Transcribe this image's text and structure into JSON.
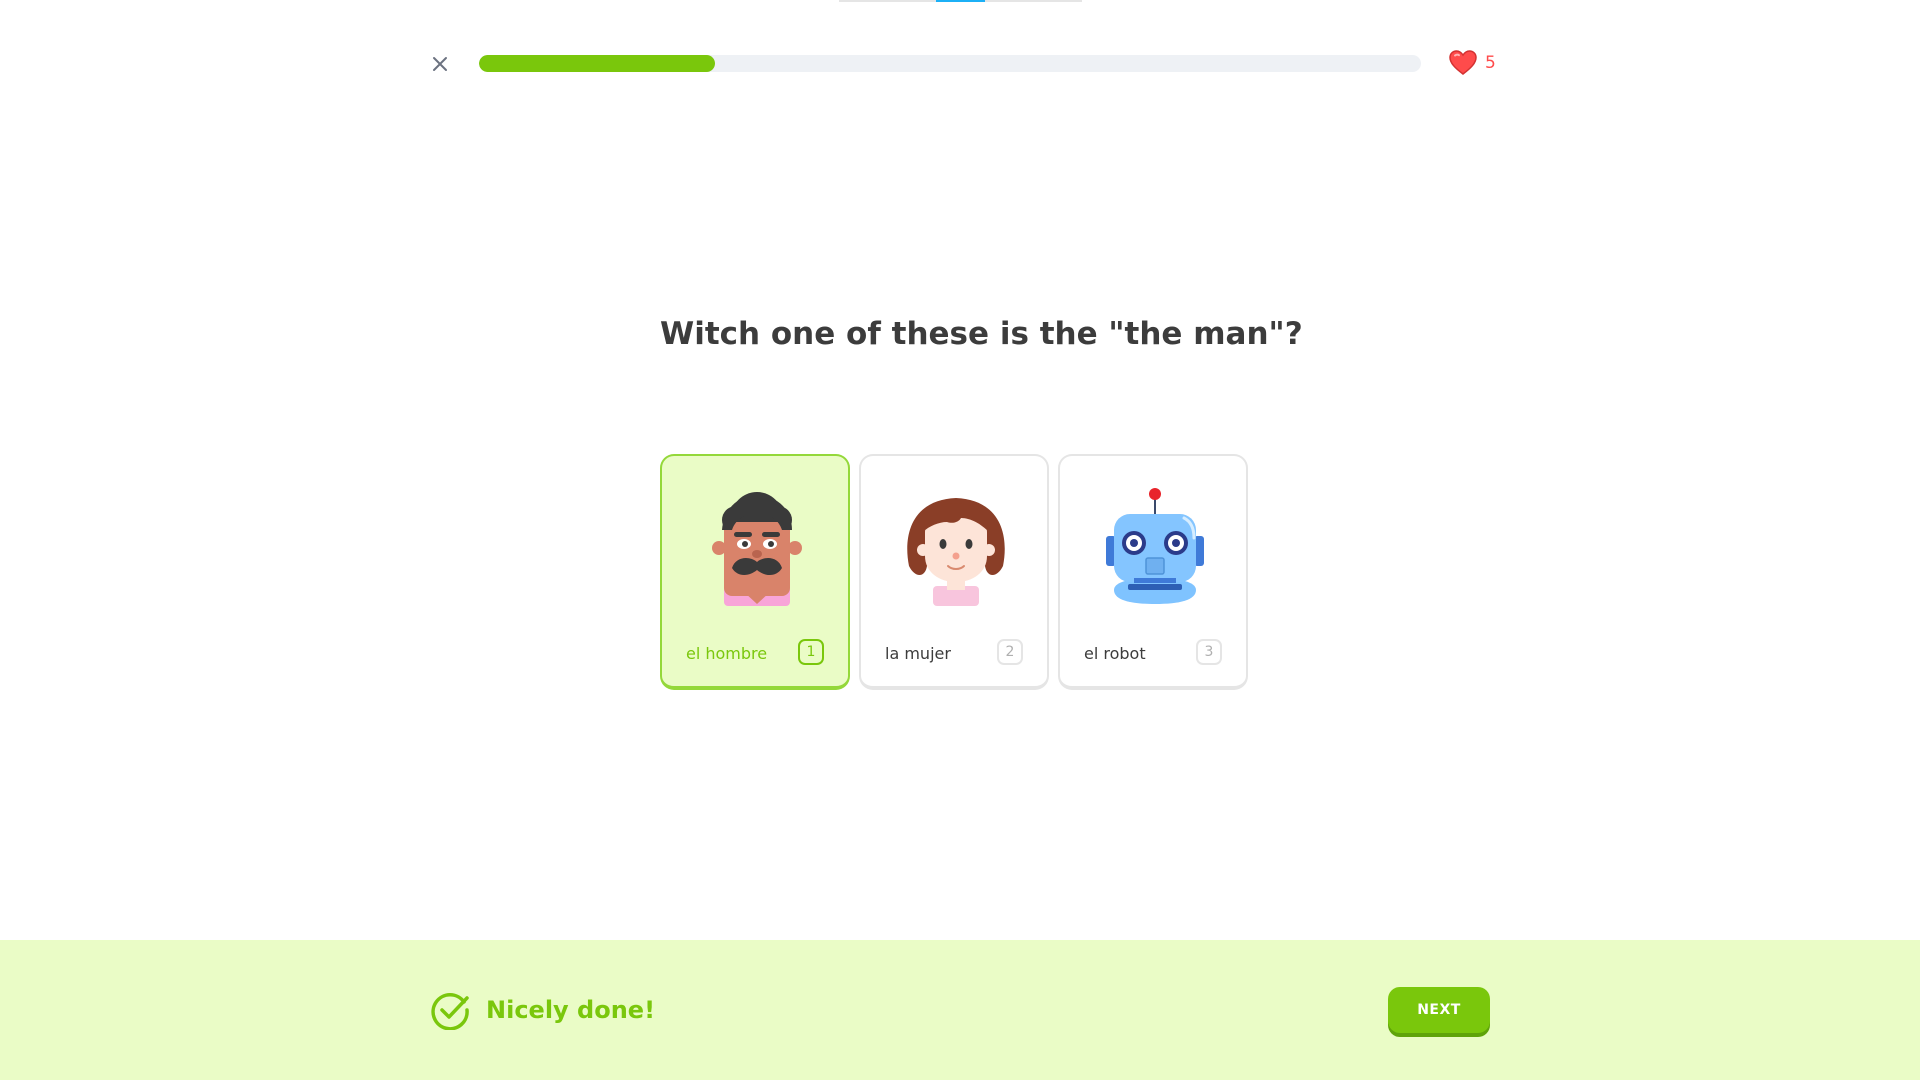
{
  "header": {
    "progress_fraction": 0.25,
    "hearts_count": "5",
    "close_icon": "close-icon",
    "heart_icon": "heart-icon"
  },
  "question": {
    "text": "Witch one of these is the \"the man\"?"
  },
  "choices": [
    {
      "label": "el hombre",
      "key": "1",
      "icon": "man-illustration",
      "selected": true
    },
    {
      "label": "la mujer",
      "key": "2",
      "icon": "woman-illustration",
      "selected": false
    },
    {
      "label": "el robot",
      "key": "3",
      "icon": "robot-illustration",
      "selected": false
    }
  ],
  "footer": {
    "feedback_text": "Nicely done!",
    "next_label": "NEXT",
    "check_icon": "check-circle-icon"
  },
  "colors": {
    "accent_green": "#7ac70c",
    "selected_bg": "#eafcc6",
    "progress_track": "#eef1f5",
    "heart_red": "#ff4b4b",
    "text_dark": "#3c3c3c"
  }
}
